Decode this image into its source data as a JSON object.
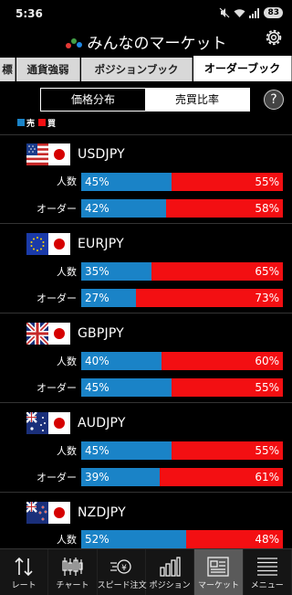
{
  "status_bar": {
    "time": "5:36",
    "battery": "83"
  },
  "header": {
    "title": "みんなのマーケット"
  },
  "tabs": [
    "標",
    "通貨強弱",
    "ポジションブック",
    "オーダーブック"
  ],
  "segment": {
    "left": "価格分布",
    "right": "売買比率"
  },
  "help_label": "?",
  "legend": {
    "sell": "売",
    "buy": "買",
    "sell_color": "#1a83c7",
    "buy_color": "#f30f12"
  },
  "pairs": [
    {
      "name": "USDJPY",
      "base_flag": "us-flag-icon",
      "rows": [
        {
          "label": "人数",
          "sell": 45,
          "buy": 55,
          "sell_text": "45%",
          "buy_text": "55%"
        },
        {
          "label": "オーダー",
          "sell": 42,
          "buy": 58,
          "sell_text": "42%",
          "buy_text": "58%"
        }
      ]
    },
    {
      "name": "EURJPY",
      "base_flag": "eu-flag-icon",
      "rows": [
        {
          "label": "人数",
          "sell": 35,
          "buy": 65,
          "sell_text": "35%",
          "buy_text": "65%"
        },
        {
          "label": "オーダー",
          "sell": 27,
          "buy": 73,
          "sell_text": "27%",
          "buy_text": "73%"
        }
      ]
    },
    {
      "name": "GBPJPY",
      "base_flag": "uk-flag-icon",
      "rows": [
        {
          "label": "人数",
          "sell": 40,
          "buy": 60,
          "sell_text": "40%",
          "buy_text": "60%"
        },
        {
          "label": "オーダー",
          "sell": 45,
          "buy": 55,
          "sell_text": "45%",
          "buy_text": "55%"
        }
      ]
    },
    {
      "name": "AUDJPY",
      "base_flag": "au-flag-icon",
      "rows": [
        {
          "label": "人数",
          "sell": 45,
          "buy": 55,
          "sell_text": "45%",
          "buy_text": "55%"
        },
        {
          "label": "オーダー",
          "sell": 39,
          "buy": 61,
          "sell_text": "39%",
          "buy_text": "61%"
        }
      ]
    },
    {
      "name": "NZDJPY",
      "base_flag": "nz-flag-icon",
      "rows": [
        {
          "label": "人数",
          "sell": 52,
          "buy": 48,
          "sell_text": "52%",
          "buy_text": "48%"
        }
      ]
    }
  ],
  "bottom_nav": [
    {
      "label": "レート",
      "icon": "rate-arrows-icon"
    },
    {
      "label": "チャート",
      "icon": "candlestick-chart-icon"
    },
    {
      "label": "スピード注文",
      "icon": "speed-order-icon"
    },
    {
      "label": "ポジション",
      "icon": "position-bars-icon"
    },
    {
      "label": "マーケット",
      "icon": "market-news-icon"
    },
    {
      "label": "メニュー",
      "icon": "menu-lines-icon"
    }
  ]
}
